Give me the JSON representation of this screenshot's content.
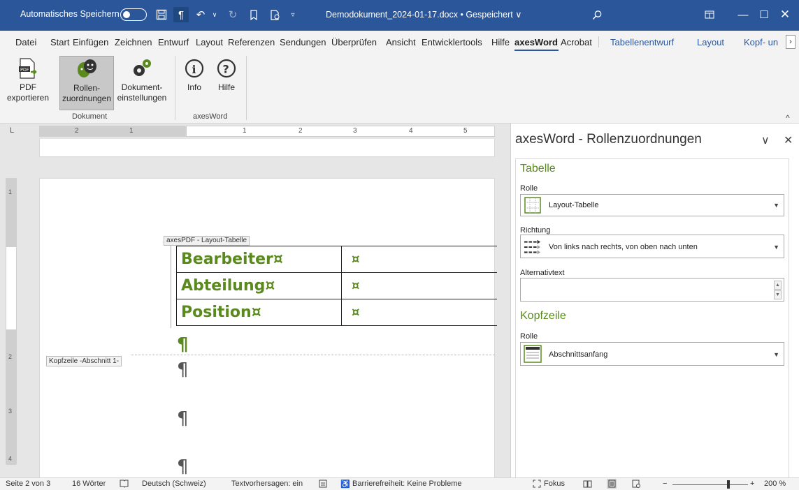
{
  "titlebar": {
    "autosave_label": "Automatisches Speichern",
    "doc_title": "Demodokument_2024-01-17.docx • Gespeichert ∨"
  },
  "menu": {
    "items": [
      "Datei",
      "Start",
      "Einfügen",
      "Zeichnen",
      "Entwurf",
      "Layout",
      "Referenzen",
      "Sendungen",
      "Überprüfen",
      "Ansicht",
      "Entwicklertools",
      "Hilfe",
      "axesWord",
      "Acrobat"
    ],
    "context_items": [
      "Tabellenentwurf",
      "Layout",
      "Kopf- un"
    ],
    "active": "axesWord"
  },
  "ribbon": {
    "pdf_label_1": "PDF",
    "pdf_label_2": "exportieren",
    "rollen_label_1": "Rollen-",
    "rollen_label_2": "zuordnungen",
    "dok_label_1": "Dokument-",
    "dok_label_2": "einstellungen",
    "info_label": "Info",
    "hilfe_label": "Hilfe",
    "group_dokument": "Dokument",
    "group_axesword": "axesWord"
  },
  "ruler": {
    "numbers": [
      "2",
      "1",
      "1",
      "2",
      "3",
      "4",
      "5"
    ]
  },
  "vruler": {
    "numbers": [
      "1",
      "2",
      "3",
      "4"
    ]
  },
  "document": {
    "table_tag": "axesPDF - Layout-Tabelle",
    "rows": [
      {
        "label": "Bearbeiter¤",
        "value": "¤"
      },
      {
        "label": "Abteilung¤",
        "value": "¤"
      },
      {
        "label": "Position¤",
        "value": "¤"
      }
    ],
    "pilcrow": "¶",
    "header_label": "Kopfzeile -Abschnitt 1-"
  },
  "pane": {
    "title": "axesWord - Rollenzuordnungen",
    "section_table": "Tabelle",
    "rolle_label": "Rolle",
    "rolle_value": "Layout-Tabelle",
    "richtung_label": "Richtung",
    "richtung_value": "Von links nach rechts, von oben nach unten",
    "alttext_label": "Alternativtext",
    "alttext_value": "",
    "section_header": "Kopfzeile",
    "rolle2_label": "Rolle",
    "rolle2_value": "Abschnittsanfang"
  },
  "status": {
    "page": "Seite 2 von 3",
    "words": "16 Wörter",
    "language": "Deutsch (Schweiz)",
    "predictions": "Textvorhersagen: ein",
    "accessibility": "Barrierefreiheit: Keine Probleme",
    "focus": "Fokus",
    "zoom": "200 %"
  },
  "colors": {
    "brand": "#2b579a",
    "accent_green": "#5a8a1e"
  }
}
